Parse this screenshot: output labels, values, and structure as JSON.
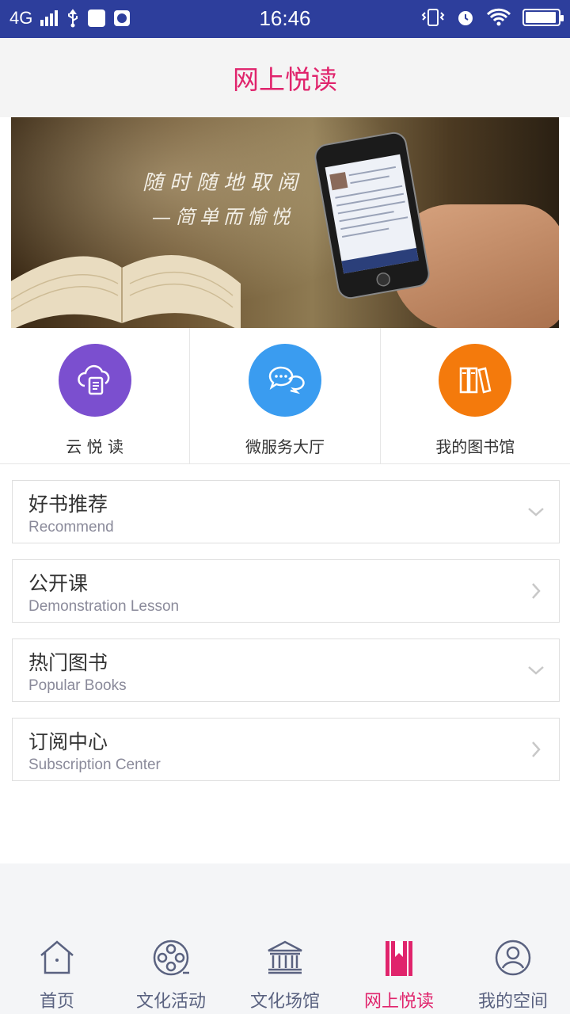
{
  "status_bar": {
    "network": "4G",
    "time": "16:46"
  },
  "header": {
    "title": "网上悦读"
  },
  "banner": {
    "line1": "随时随地取阅",
    "line2": "—简单而愉悦"
  },
  "quick_entries": [
    {
      "label": "云 悦 读",
      "icon": "cloud-document-icon",
      "color": "#7b4fcf"
    },
    {
      "label": "微服务大厅",
      "icon": "chat-bubbles-icon",
      "color": "#3a9cf0"
    },
    {
      "label": "我的图书馆",
      "icon": "bookshelf-icon",
      "color": "#f47a0c"
    }
  ],
  "sections": [
    {
      "title": "好书推荐",
      "subtitle": "Recommend",
      "arrow": "chevron-down-icon"
    },
    {
      "title": "公开课",
      "subtitle": "Demonstration Lesson",
      "arrow": "chevron-right-icon"
    },
    {
      "title": "热门图书",
      "subtitle": "Popular Books",
      "arrow": "chevron-down-icon"
    },
    {
      "title": "订阅中心",
      "subtitle": "Subscription Center",
      "arrow": "chevron-right-icon"
    }
  ],
  "bottom_nav": [
    {
      "label": "首页",
      "icon": "home-icon",
      "active": false
    },
    {
      "label": "文化活动",
      "icon": "film-reel-icon",
      "active": false
    },
    {
      "label": "文化场馆",
      "icon": "museum-icon",
      "active": false
    },
    {
      "label": "网上悦读",
      "icon": "bookmark-icon",
      "active": true
    },
    {
      "label": "我的空间",
      "icon": "user-icon",
      "active": false
    }
  ],
  "colors": {
    "status_bar": "#2d3e9c",
    "accent": "#e0246c",
    "nav_inactive": "#5a6280"
  }
}
